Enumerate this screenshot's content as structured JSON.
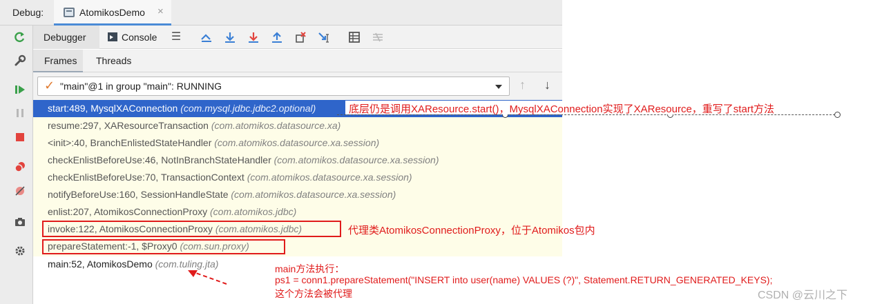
{
  "header": {
    "debug_label": "Debug:",
    "run_tab_title": "AtomikosDemo",
    "close_glyph": "×"
  },
  "tool_tabs": {
    "debugger": "Debugger",
    "console": "Console"
  },
  "sub_tabs": {
    "frames": "Frames",
    "threads": "Threads"
  },
  "thread_selector": {
    "value": "\"main\"@1 in group \"main\": RUNNING"
  },
  "frames": [
    {
      "method": "start:489, MysqlXAConnection ",
      "pkg": "(com.mysql.jdbc.jdbc2.optional)"
    },
    {
      "method": "resume:297, XAResourceTransaction ",
      "pkg": "(com.atomikos.datasource.xa)"
    },
    {
      "method": "<init>:40, BranchEnlistedStateHandler ",
      "pkg": "(com.atomikos.datasource.xa.session)"
    },
    {
      "method": "checkEnlistBeforeUse:46, NotInBranchStateHandler ",
      "pkg": "(com.atomikos.datasource.xa.session)"
    },
    {
      "method": "checkEnlistBeforeUse:70, TransactionContext ",
      "pkg": "(com.atomikos.datasource.xa.session)"
    },
    {
      "method": "notifyBeforeUse:160, SessionHandleState ",
      "pkg": "(com.atomikos.datasource.xa.session)"
    },
    {
      "method": "enlist:207, AtomikosConnectionProxy ",
      "pkg": "(com.atomikos.jdbc)"
    },
    {
      "method": "invoke:122, AtomikosConnectionProxy ",
      "pkg": "(com.atomikos.jdbc)"
    },
    {
      "method": "prepareStatement:-1, $Proxy0 ",
      "pkg": "(com.sun.proxy)"
    },
    {
      "method": "main:52, AtomikosDemo ",
      "pkg": "(com.tuling.jta)"
    }
  ],
  "annotations": {
    "xa_note": "底层仍是调用XAResource.start()，MysqlXAConnection实现了XAResource，重写了start方法",
    "proxy_note": "代理类AtomikosConnectionProxy，位于Atomikos包内",
    "main_line1": "main方法执行：",
    "main_line2": "ps1 = conn1.prepareStatement(\"INSERT into user(name) VALUES (?)\", Statement.RETURN_GENERATED_KEYS);",
    "main_line3": "这个方法会被代理"
  },
  "watermark": "CSDN @云川之下",
  "colors": {
    "selection": "#2f65ca",
    "frames_bg": "#fefde8",
    "annotation_red": "#e01b1b",
    "toolbar_bg": "#ececec"
  },
  "icons": {
    "rerun": "rerun-icon",
    "settings_wrench": "wrench-icon",
    "resume": "resume-icon",
    "pause": "pause-icon",
    "stop": "stop-icon",
    "view_breakpoints": "breakpoints-icon",
    "mute_breakpoints": "mute-breakpoints-icon",
    "camera": "camera-icon",
    "gear": "gear-icon"
  }
}
